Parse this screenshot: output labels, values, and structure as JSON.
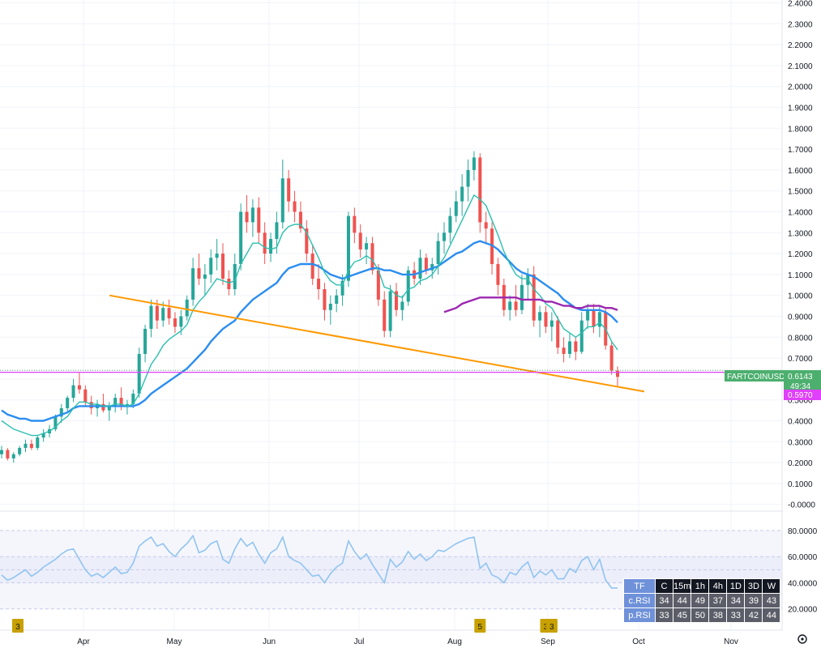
{
  "chart_data": {
    "type": "candlestick",
    "price_axis": {
      "ticks": [
        "2.4000",
        "2.3000",
        "2.2000",
        "2.1000",
        "2.0000",
        "1.9000",
        "1.8000",
        "1.7000",
        "1.6000",
        "1.5000",
        "1.4000",
        "1.3000",
        "1.2000",
        "1.1000",
        "1.0000",
        "0.9000",
        "0.8000",
        "0.7000",
        "0.6000",
        "0.5000",
        "0.4000",
        "0.3000",
        "0.2000",
        "0.1000",
        "-0.0000"
      ],
      "ylim": [
        0,
        2.4
      ]
    },
    "rsi_axis": {
      "ticks": [
        "80.0000",
        "60.0000",
        "40.0000",
        "20.0000"
      ],
      "ylim": [
        20,
        80
      ]
    },
    "time_axis": {
      "ticks": [
        "Apr",
        "May",
        "Jun",
        "Jul",
        "Aug",
        "Sep",
        "Oct",
        "Nov"
      ]
    },
    "symbol_label": "FARTCOINUSDT.P",
    "last_price": "0.6143",
    "countdown": "49:34",
    "horizontal_line_price": "0.5970",
    "candles": [
      [
        0.24,
        0.28,
        0.22,
        0.26
      ],
      [
        0.26,
        0.27,
        0.21,
        0.22
      ],
      [
        0.22,
        0.25,
        0.2,
        0.24
      ],
      [
        0.24,
        0.28,
        0.23,
        0.27
      ],
      [
        0.27,
        0.31,
        0.25,
        0.29
      ],
      [
        0.29,
        0.31,
        0.26,
        0.27
      ],
      [
        0.27,
        0.33,
        0.26,
        0.32
      ],
      [
        0.32,
        0.36,
        0.3,
        0.34
      ],
      [
        0.34,
        0.38,
        0.32,
        0.36
      ],
      [
        0.36,
        0.43,
        0.35,
        0.42
      ],
      [
        0.42,
        0.48,
        0.39,
        0.46
      ],
      [
        0.46,
        0.52,
        0.44,
        0.51
      ],
      [
        0.51,
        0.6,
        0.49,
        0.57
      ],
      [
        0.57,
        0.63,
        0.53,
        0.55
      ],
      [
        0.55,
        0.57,
        0.47,
        0.49
      ],
      [
        0.49,
        0.52,
        0.43,
        0.46
      ],
      [
        0.46,
        0.5,
        0.42,
        0.48
      ],
      [
        0.48,
        0.53,
        0.44,
        0.45
      ],
      [
        0.45,
        0.49,
        0.4,
        0.47
      ],
      [
        0.47,
        0.53,
        0.44,
        0.51
      ],
      [
        0.51,
        0.56,
        0.45,
        0.47
      ],
      [
        0.47,
        0.5,
        0.43,
        0.48
      ],
      [
        0.48,
        0.55,
        0.46,
        0.53
      ],
      [
        0.53,
        0.75,
        0.51,
        0.72
      ],
      [
        0.72,
        0.86,
        0.68,
        0.84
      ],
      [
        0.84,
        0.98,
        0.8,
        0.95
      ],
      [
        0.95,
        0.98,
        0.84,
        0.88
      ],
      [
        0.88,
        0.97,
        0.85,
        0.94
      ],
      [
        0.94,
        0.98,
        0.86,
        0.89
      ],
      [
        0.89,
        0.92,
        0.82,
        0.85
      ],
      [
        0.85,
        0.93,
        0.81,
        0.9
      ],
      [
        0.9,
        1.0,
        0.88,
        0.98
      ],
      [
        0.98,
        1.18,
        0.95,
        1.13
      ],
      [
        1.13,
        1.2,
        1.05,
        1.08
      ],
      [
        1.08,
        1.15,
        1.0,
        1.1
      ],
      [
        1.1,
        1.22,
        1.06,
        1.18
      ],
      [
        1.18,
        1.27,
        1.12,
        1.2
      ],
      [
        1.2,
        1.25,
        1.05,
        1.08
      ],
      [
        1.08,
        1.12,
        1.0,
        1.03
      ],
      [
        1.03,
        1.2,
        1.0,
        1.15
      ],
      [
        1.15,
        1.44,
        1.12,
        1.4
      ],
      [
        1.4,
        1.48,
        1.3,
        1.35
      ],
      [
        1.35,
        1.46,
        1.28,
        1.42
      ],
      [
        1.42,
        1.47,
        1.25,
        1.3
      ],
      [
        1.3,
        1.35,
        1.15,
        1.2
      ],
      [
        1.2,
        1.3,
        1.16,
        1.27
      ],
      [
        1.27,
        1.4,
        1.2,
        1.35
      ],
      [
        1.35,
        1.65,
        1.32,
        1.56
      ],
      [
        1.56,
        1.6,
        1.4,
        1.45
      ],
      [
        1.45,
        1.5,
        1.35,
        1.4
      ],
      [
        1.4,
        1.45,
        1.3,
        1.32
      ],
      [
        1.32,
        1.36,
        1.16,
        1.2
      ],
      [
        1.2,
        1.24,
        1.05,
        1.08
      ],
      [
        1.08,
        1.15,
        0.98,
        1.03
      ],
      [
        1.03,
        1.06,
        0.88,
        0.93
      ],
      [
        0.93,
        1.0,
        0.86,
        0.96
      ],
      [
        0.96,
        1.03,
        0.92,
        1.0
      ],
      [
        1.0,
        1.1,
        0.95,
        1.07
      ],
      [
        1.07,
        1.4,
        1.04,
        1.38
      ],
      [
        1.38,
        1.42,
        1.25,
        1.3
      ],
      [
        1.3,
        1.34,
        1.18,
        1.22
      ],
      [
        1.22,
        1.28,
        1.15,
        1.25
      ],
      [
        1.25,
        1.28,
        1.1,
        1.12
      ],
      [
        1.12,
        1.15,
        0.95,
        0.98
      ],
      [
        0.98,
        1.02,
        0.8,
        0.83
      ],
      [
        0.83,
        1.05,
        0.8,
        1.02
      ],
      [
        1.02,
        1.06,
        0.9,
        0.93
      ],
      [
        0.93,
        1.0,
        0.88,
        0.97
      ],
      [
        0.97,
        1.14,
        0.95,
        1.12
      ],
      [
        1.12,
        1.16,
        1.05,
        1.08
      ],
      [
        1.08,
        1.22,
        1.05,
        1.18
      ],
      [
        1.18,
        1.2,
        1.1,
        1.12
      ],
      [
        1.12,
        1.18,
        1.08,
        1.15
      ],
      [
        1.15,
        1.3,
        1.1,
        1.26
      ],
      [
        1.26,
        1.35,
        1.2,
        1.3
      ],
      [
        1.3,
        1.42,
        1.25,
        1.38
      ],
      [
        1.38,
        1.5,
        1.35,
        1.45
      ],
      [
        1.45,
        1.58,
        1.38,
        1.52
      ],
      [
        1.52,
        1.65,
        1.45,
        1.6
      ],
      [
        1.6,
        1.69,
        1.55,
        1.66
      ],
      [
        1.66,
        1.68,
        1.3,
        1.35
      ],
      [
        1.35,
        1.4,
        1.25,
        1.32
      ],
      [
        1.32,
        1.35,
        1.1,
        1.15
      ],
      [
        1.15,
        1.18,
        1.0,
        1.05
      ],
      [
        1.05,
        1.08,
        0.9,
        0.93
      ],
      [
        0.93,
        1.0,
        0.88,
        0.97
      ],
      [
        0.97,
        1.05,
        0.9,
        0.93
      ],
      [
        0.93,
        1.1,
        0.91,
        1.05
      ],
      [
        1.05,
        1.13,
        0.98,
        1.1
      ],
      [
        1.1,
        1.14,
        0.85,
        0.88
      ],
      [
        0.88,
        0.95,
        0.8,
        0.92
      ],
      [
        0.92,
        0.95,
        0.82,
        0.85
      ],
      [
        0.85,
        0.92,
        0.78,
        0.88
      ],
      [
        0.88,
        0.9,
        0.72,
        0.75
      ],
      [
        0.75,
        0.8,
        0.68,
        0.72
      ],
      [
        0.72,
        0.82,
        0.7,
        0.78
      ],
      [
        0.78,
        0.8,
        0.69,
        0.73
      ],
      [
        0.73,
        0.92,
        0.72,
        0.88
      ],
      [
        0.88,
        0.96,
        0.84,
        0.93
      ],
      [
        0.93,
        0.96,
        0.82,
        0.85
      ],
      [
        0.85,
        0.95,
        0.8,
        0.92
      ],
      [
        0.92,
        0.94,
        0.74,
        0.76
      ],
      [
        0.76,
        0.78,
        0.62,
        0.64
      ],
      [
        0.64,
        0.66,
        0.56,
        0.61
      ]
    ],
    "series": [
      {
        "name": "",
        "color": "#2b8df0",
        "values": [
          0.45,
          0.43,
          0.42,
          0.41,
          0.41,
          0.4,
          0.4,
          0.4,
          0.41,
          0.42,
          0.43,
          0.44,
          0.46,
          0.47,
          0.47,
          0.47,
          0.47,
          0.47,
          0.47,
          0.47,
          0.47,
          0.47,
          0.47,
          0.48,
          0.5,
          0.53,
          0.55,
          0.57,
          0.59,
          0.61,
          0.63,
          0.65,
          0.68,
          0.71,
          0.74,
          0.78,
          0.81,
          0.84,
          0.86,
          0.88,
          0.92,
          0.95,
          0.98,
          1.0,
          1.02,
          1.04,
          1.06,
          1.1,
          1.13,
          1.14,
          1.15,
          1.15,
          1.15,
          1.14,
          1.12,
          1.1,
          1.09,
          1.08,
          1.09,
          1.1,
          1.11,
          1.12,
          1.13,
          1.13,
          1.12,
          1.12,
          1.11,
          1.1,
          1.1,
          1.1,
          1.11,
          1.12,
          1.13,
          1.14,
          1.16,
          1.18,
          1.2,
          1.21,
          1.23,
          1.25,
          1.26,
          1.25,
          1.24,
          1.22,
          1.19,
          1.16,
          1.13,
          1.11,
          1.1,
          1.09,
          1.07,
          1.05,
          1.03,
          1.01,
          0.98,
          0.96,
          0.94,
          0.93,
          0.93,
          0.93,
          0.93,
          0.92,
          0.9,
          0.87
        ]
      },
      {
        "name": "",
        "color": "#2bbfae",
        "values": [
          0.4,
          0.38,
          0.36,
          0.35,
          0.34,
          0.33,
          0.33,
          0.34,
          0.35,
          0.37,
          0.4,
          0.42,
          0.46,
          0.49,
          0.49,
          0.48,
          0.48,
          0.47,
          0.47,
          0.48,
          0.48,
          0.47,
          0.48,
          0.53,
          0.6,
          0.67,
          0.71,
          0.76,
          0.79,
          0.81,
          0.83,
          0.86,
          0.93,
          0.97,
          1.0,
          1.04,
          1.08,
          1.07,
          1.06,
          1.07,
          1.15,
          1.2,
          1.25,
          1.25,
          1.23,
          1.22,
          1.23,
          1.3,
          1.33,
          1.34,
          1.34,
          1.3,
          1.24,
          1.18,
          1.11,
          1.07,
          1.05,
          1.05,
          1.12,
          1.16,
          1.17,
          1.19,
          1.17,
          1.12,
          1.04,
          1.03,
          1.0,
          0.99,
          1.03,
          1.04,
          1.07,
          1.08,
          1.1,
          1.14,
          1.18,
          1.24,
          1.3,
          1.36,
          1.42,
          1.48,
          1.46,
          1.43,
          1.36,
          1.29,
          1.21,
          1.15,
          1.1,
          1.08,
          1.08,
          1.03,
          1.0,
          0.96,
          0.94,
          0.89,
          0.84,
          0.82,
          0.8,
          0.82,
          0.85,
          0.85,
          0.87,
          0.84,
          0.78,
          0.74
        ]
      },
      {
        "name": "",
        "color": "#9c27b0",
        "values": [
          null,
          null,
          null,
          null,
          null,
          null,
          null,
          null,
          null,
          null,
          null,
          null,
          null,
          null,
          null,
          null,
          null,
          null,
          null,
          null,
          null,
          null,
          null,
          null,
          null,
          null,
          null,
          null,
          null,
          null,
          null,
          null,
          null,
          null,
          null,
          null,
          null,
          null,
          null,
          null,
          null,
          null,
          null,
          null,
          null,
          null,
          null,
          null,
          null,
          null,
          null,
          null,
          null,
          null,
          null,
          null,
          null,
          null,
          null,
          null,
          null,
          null,
          null,
          null,
          null,
          null,
          null,
          null,
          null,
          null,
          null,
          null,
          null,
          null,
          0.92,
          0.93,
          0.94,
          0.96,
          0.97,
          0.98,
          0.99,
          0.99,
          0.99,
          0.99,
          0.99,
          0.99,
          0.99,
          0.98,
          0.98,
          0.98,
          0.98,
          0.97,
          0.97,
          0.96,
          0.95,
          0.95,
          0.94,
          0.94,
          0.95,
          0.95,
          0.95,
          0.94,
          0.94,
          0.93
        ]
      }
    ],
    "rsi_series": [
      {
        "name": "",
        "color": "#90c4f0",
        "values": [
          46,
          42,
          44,
          47,
          50,
          45,
          48,
          52,
          55,
          58,
          62,
          65,
          66,
          58,
          50,
          45,
          47,
          44,
          48,
          52,
          47,
          48,
          55,
          68,
          72,
          75,
          68,
          70,
          64,
          60,
          66,
          70,
          76,
          63,
          65,
          70,
          72,
          58,
          55,
          66,
          74,
          68,
          71,
          62,
          55,
          63,
          66,
          75,
          60,
          57,
          55,
          50,
          45,
          46,
          40,
          47,
          52,
          55,
          72,
          64,
          58,
          62,
          54,
          47,
          40,
          58,
          52,
          56,
          64,
          58,
          62,
          57,
          60,
          65,
          64,
          67,
          70,
          72,
          74,
          75,
          51,
          55,
          46,
          44,
          40,
          48,
          46,
          52,
          56,
          44,
          49,
          46,
          50,
          43,
          43,
          51,
          48,
          57,
          60,
          50,
          58,
          42,
          36,
          36
        ]
      }
    ],
    "rsi_table": {
      "headers": [
        "TF",
        "C",
        "15m",
        "1h",
        "4h",
        "1D",
        "3D",
        "W"
      ],
      "rows": [
        {
          "label": "c.RSI",
          "values": [
            "34",
            "44",
            "49",
            "37",
            "34",
            "39",
            "43"
          ]
        },
        {
          "label": "p.RSI",
          "values": [
            "33",
            "45",
            "50",
            "38",
            "33",
            "42",
            "44"
          ]
        }
      ]
    },
    "event_markers": [
      {
        "label": "3",
        "index": 0
      },
      {
        "label": "5",
        "index": 80
      },
      {
        "label": "3",
        "index": 91
      },
      {
        "label": "3",
        "index": 92
      }
    ],
    "colors": {
      "up": "#26a69a",
      "down": "#ef5350",
      "trendline": "#ff9800",
      "hline": "#e040fb",
      "symbol_badge": "#4caf6e"
    }
  }
}
